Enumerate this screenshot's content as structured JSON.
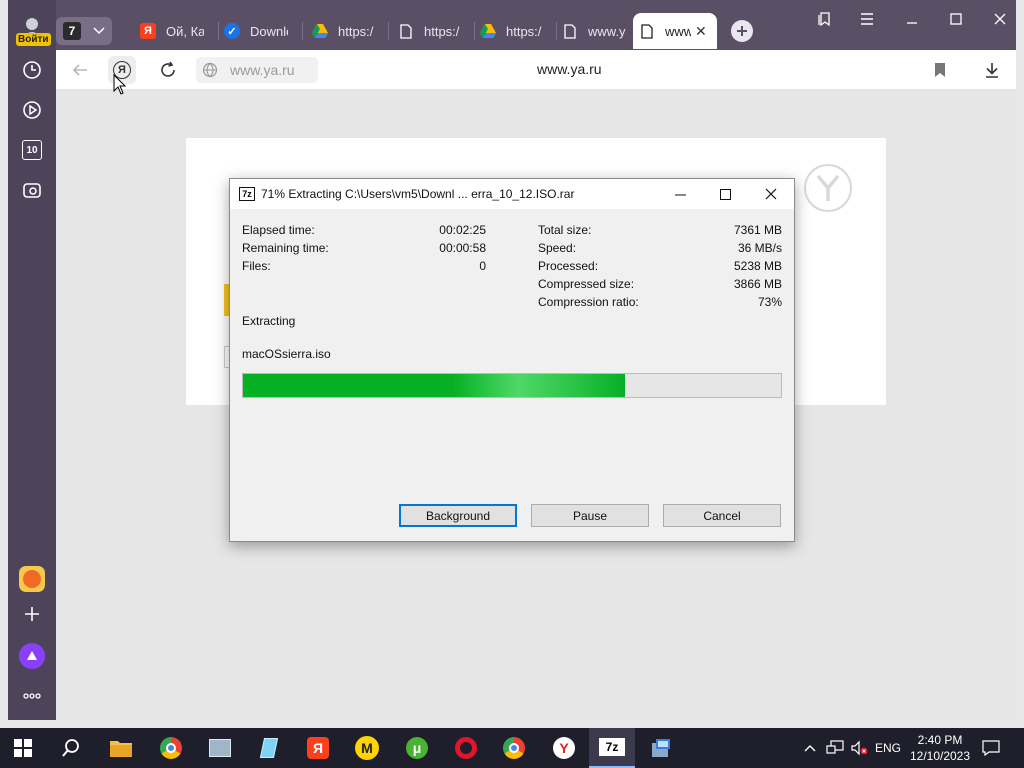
{
  "browser": {
    "sidebar": {
      "login_label": "Войти",
      "tab_count": "7",
      "items": [
        {
          "name": "history-icon"
        },
        {
          "name": "play-icon"
        },
        {
          "name": "ten-icon",
          "text": "10"
        },
        {
          "name": "camera-icon"
        }
      ],
      "bottom": [
        "mail-app-icon",
        "add-icon",
        "alice-icon",
        "more-icon"
      ]
    },
    "tabs": [
      {
        "label": "Ой, Ка",
        "icon": "yandex-icon"
      },
      {
        "label": "Downlo",
        "icon": "check-icon"
      },
      {
        "label": "https:/",
        "icon": "drive-icon"
      },
      {
        "label": "https:/",
        "icon": "page-icon"
      },
      {
        "label": "https:/",
        "icon": "drive-icon"
      },
      {
        "label": "www.y",
        "icon": "page-icon"
      },
      {
        "label": "www",
        "icon": "page-icon",
        "active": true
      }
    ],
    "address": {
      "url_text": "www.ya.ru",
      "page_title": "www.ya.ru"
    }
  },
  "dialog": {
    "title": "71% Extracting C:\\Users\\vm5\\Downl ... erra_10_12.ISO.rar",
    "icon_text": "7z",
    "left_stats": [
      {
        "label": "Elapsed time:",
        "value": "00:02:25"
      },
      {
        "label": "Remaining time:",
        "value": "00:00:58"
      },
      {
        "label": "Files:",
        "value": "0"
      }
    ],
    "right_stats": [
      {
        "label": "Total size:",
        "value": "7361 MB"
      },
      {
        "label": "Speed:",
        "value": "36 MB/s"
      },
      {
        "label": "Processed:",
        "value": "5238 MB"
      },
      {
        "label": "Compressed size:",
        "value": "3866 MB"
      },
      {
        "label": "Compression ratio:",
        "value": "73%"
      }
    ],
    "status": "Extracting",
    "current_file": "macOSsierra.iso",
    "progress": 0.71,
    "buttons": {
      "background": "Background",
      "pause": "Pause",
      "cancel": "Cancel"
    }
  },
  "taskbar": {
    "apps": [
      "start-icon",
      "search-icon",
      "file-explorer-icon",
      "chrome-icon",
      "app-icon",
      "notepad-icon",
      "yandex-icon",
      "yandex-market-icon",
      "utorrent-icon",
      "opera-icon",
      "chrome-alt-icon",
      "yandex-browser-icon",
      "7zip-icon",
      "installer-icon"
    ],
    "active_app": "7zip-icon",
    "sevenzip_text": "7z",
    "language": "ENG",
    "time": "2:40 PM",
    "date": "12/10/2023"
  },
  "colors": {
    "browser_bg": "#5b4f66",
    "progress_green": "#06b025",
    "accent_blue": "#0078d7"
  }
}
